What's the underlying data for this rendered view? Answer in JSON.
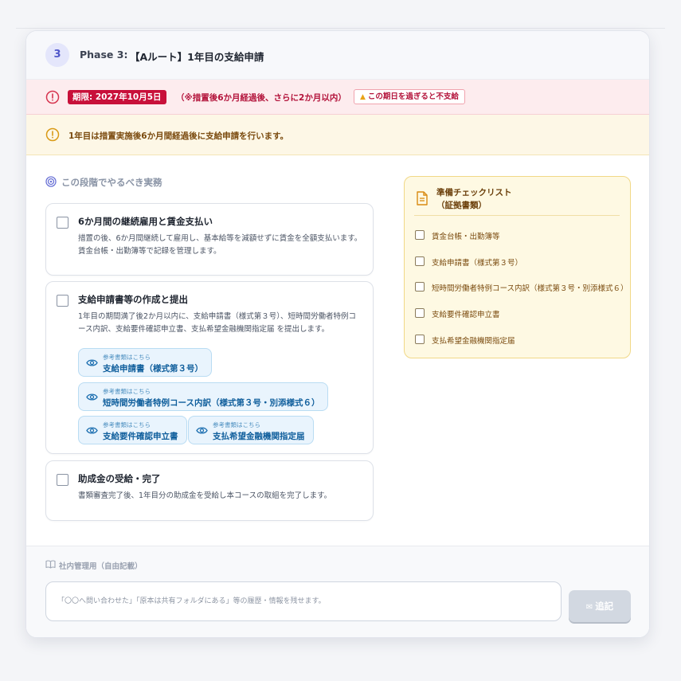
{
  "phase": {
    "number": "3",
    "label": "Phase 3:",
    "title": "【Aルート】1年目の支給申請"
  },
  "deadline": {
    "date_label": "期限: 2027年10月5日",
    "note": "（※措置後6か月経過後、さらに2か月以内）",
    "warning": "この期日を過ぎると不支給"
  },
  "info": {
    "text": "1年目は措置実施後6か月間経過後に支給申請を行います。"
  },
  "section": {
    "title": "この段階でやるべき実務"
  },
  "tasks": [
    {
      "title": "6か月間の継続雇用と賃金支払い",
      "description": "措置の後、6か月間継続して雇用し、基本給等を減額せずに賃金を全額支払います。賃金台帳・出勤簿等で記録を管理します。"
    },
    {
      "title": "支給申請書等の作成と提出",
      "description": "1年目の期間満了後2か月以内に、支給申請書（様式第３号）、短時間労働者特例コース内訳、支給要件確認申立書、支払希望金融機関指定届 を提出します。",
      "doc_links": [
        {
          "sub": "参考書類はこちら",
          "main": "支給申請書（様式第３号）"
        },
        {
          "sub": "参考書類はこちら",
          "main": "短時間労働者特例コース内訳（様式第３号・別添様式６）"
        },
        {
          "sub": "参考書類はこちら",
          "main": "支給要件確認申立書"
        },
        {
          "sub": "参考書類はこちら",
          "main": "支払希望金融機関指定届"
        }
      ]
    },
    {
      "title": "助成金の受給・完了",
      "description": "書類審査完了後、1年目分の助成金を受給し本コースの取組を完了します。"
    }
  ],
  "checklist": {
    "title_line1": "準備チェックリスト",
    "title_line2": "（証拠書類）",
    "items": [
      "賃金台帳・出勤簿等",
      "支給申請書（様式第３号）",
      "短時間労働者特例コース内訳（様式第３号・別添様式６）",
      "支給要件確認申立書",
      "支払希望金融機関指定届"
    ]
  },
  "memo": {
    "label": "社内管理用（自由記載）",
    "placeholder": "「〇〇へ問い合わせた」「原本は共有フォルダにある」等の履歴・情報を残せます。",
    "value": "",
    "add_label": "追記"
  },
  "colors": {
    "accent": "#4f56c9",
    "danger": "#c8103a",
    "info_bg": "#fdf7e6",
    "link": "#0f5e9c"
  },
  "icons": {
    "phase": "step-number",
    "deadline": "alert-circle-icon",
    "info": "info-circle-icon",
    "section": "target-icon",
    "doc_link": "eye-icon",
    "checklist": "document-icon",
    "memo": "book-icon",
    "add": "send-icon"
  }
}
